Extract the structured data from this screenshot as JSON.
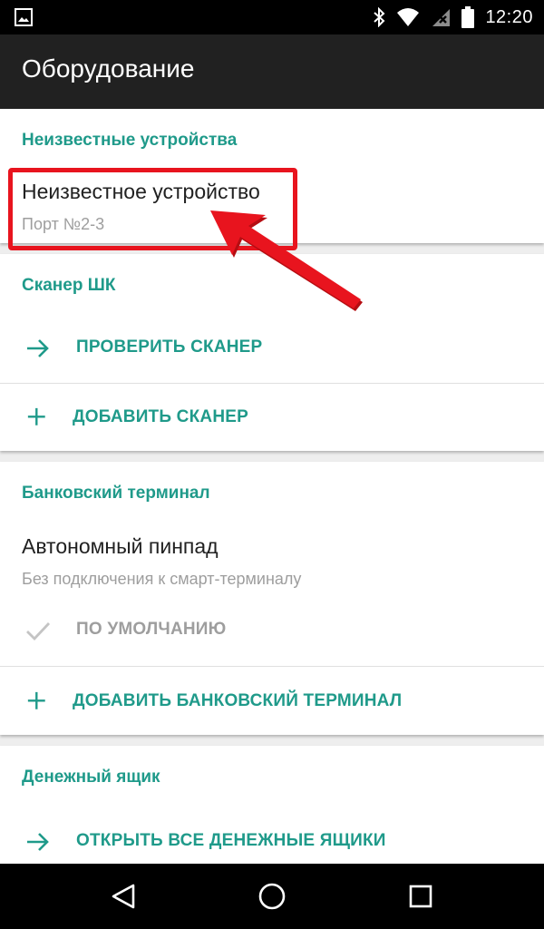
{
  "status_bar": {
    "time": "12:20",
    "icons": [
      "image-icon",
      "bluetooth-icon",
      "wifi-icon",
      "no-signal-icon",
      "battery-icon"
    ]
  },
  "app_bar": {
    "title": "Оборудование"
  },
  "sections": {
    "unknown": {
      "title": "Неизвестные устройства",
      "device_title": "Неизвестное устройство",
      "device_subtitle": "Порт №2-3"
    },
    "scanner": {
      "title": "Сканер ШК",
      "check_label": "ПРОВЕРИТЬ СКАНЕР",
      "add_label": "ДОБАВИТЬ СКАНЕР"
    },
    "bank": {
      "title": "Банковский терминал",
      "device_title": "Автономный пинпад",
      "device_subtitle": "Без подключения к смарт-терминалу",
      "default_label": "ПО УМОЛЧАНИЮ",
      "add_label": "ДОБАВИТЬ БАНКОВСКИЙ ТЕРМИНАЛ"
    },
    "cash": {
      "title": "Денежный ящик",
      "open_label": "ОТКРЫТЬ ВСЕ ДЕНЕЖНЫЕ ЯЩИКИ"
    }
  },
  "colors": {
    "accent": "#1f9a8a",
    "app_bar": "#212121",
    "highlight": "#e8141e",
    "secondary_text": "#9e9e9e"
  }
}
